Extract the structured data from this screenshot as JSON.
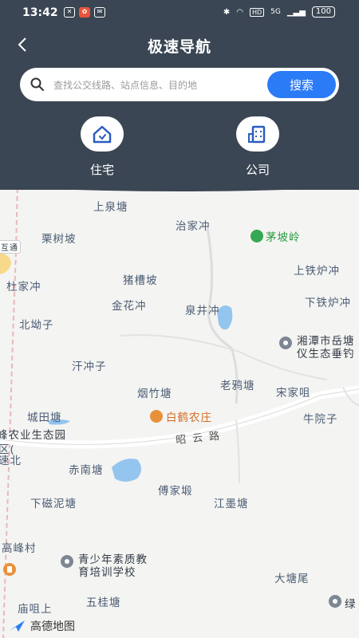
{
  "status": {
    "time": "13:42",
    "battery": "100",
    "hd": "HD",
    "net": "5G"
  },
  "nav": {
    "title": "极速导航"
  },
  "search": {
    "placeholder": "查找公交线路、站点信息、目的地",
    "button": "搜索"
  },
  "shortcuts": [
    {
      "label": "住宅",
      "icon": "home-icon"
    },
    {
      "label": "公司",
      "icon": "company-icon"
    }
  ],
  "map": {
    "pois": [
      "上泉塘",
      "治家冲",
      "茅坡岭",
      "栗树坡",
      "互通",
      "杜家冲",
      "猪槽坡",
      "上铁炉冲",
      "金花冲",
      "泉井冲",
      "下铁炉冲",
      "北坳子",
      "湘潭市岳塘",
      "仪生态垂钓",
      "汗冲子",
      "老鸦塘",
      "宋家咀",
      "烟竹塘",
      "城田塘",
      "白鹤农庄",
      "牛院子",
      "峰农业生态园",
      "区(",
      "速北",
      "赤南塘",
      "傅家塅",
      "下磁泥塘",
      "江墨塘",
      "高峰村",
      "青少年素质教",
      "育培训学校",
      "大塘尾",
      "庙咀上",
      "五桂塘",
      "绿"
    ],
    "road": "昭云路"
  },
  "logo": {
    "text": "高德地图"
  },
  "colors": {
    "header": "#3b4654",
    "accent": "#2b7bf6"
  }
}
